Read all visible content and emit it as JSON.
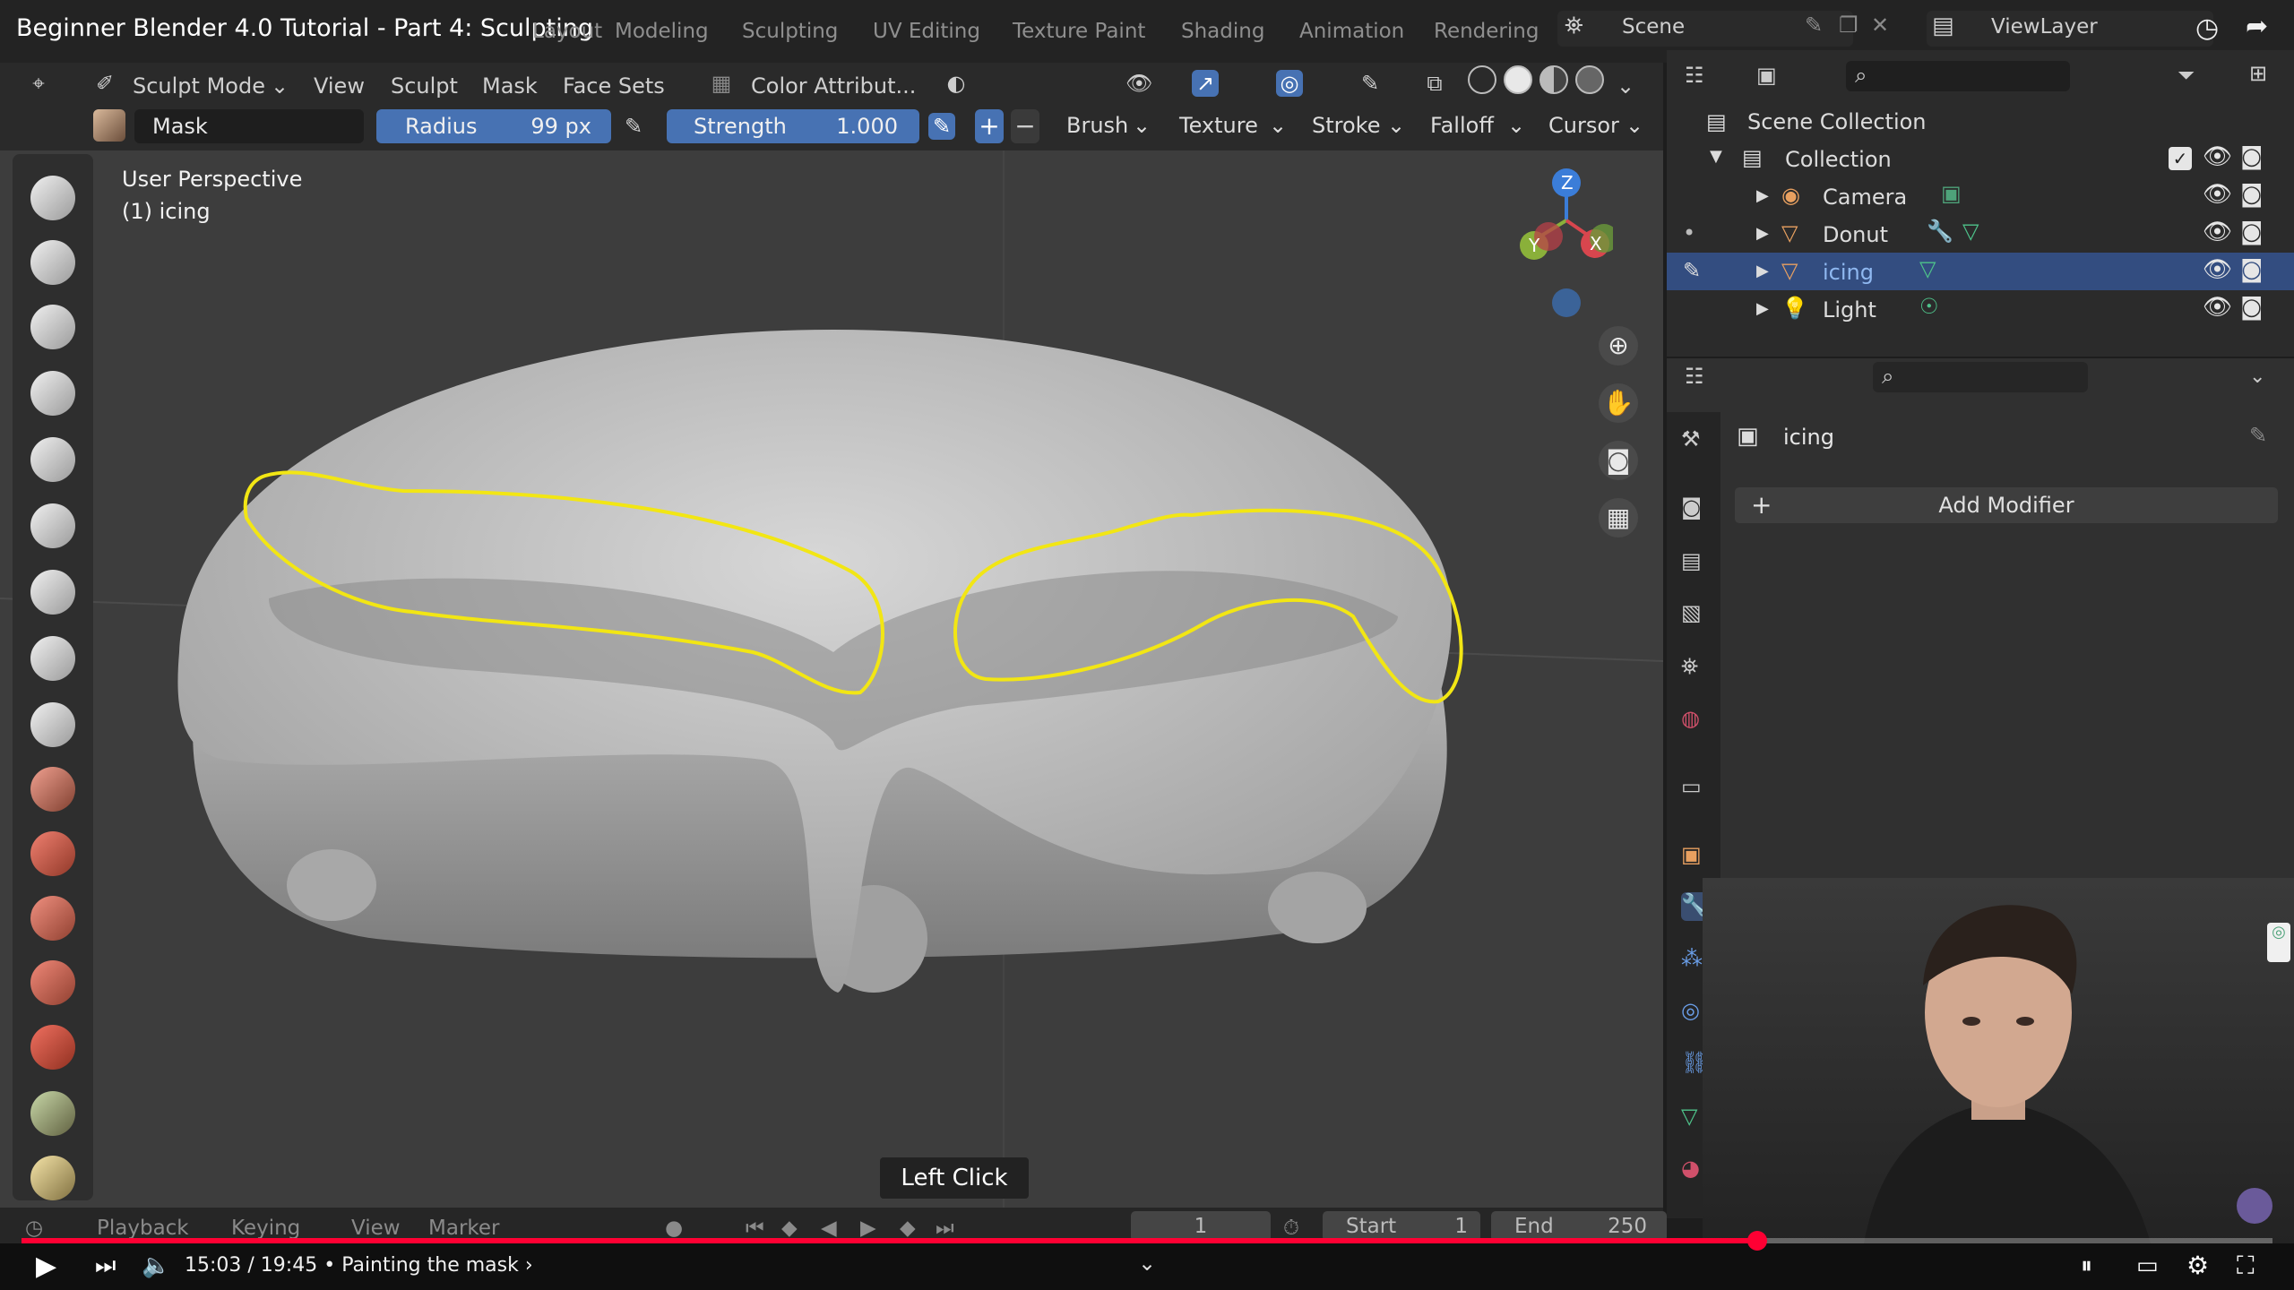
{
  "video": {
    "title": "Beginner Blender 4.0 Tutorial - Part 4: Sculpting",
    "time": "15:03 / 19:45",
    "chapter": "Painting the mask",
    "progress_fraction": 0.7711
  },
  "workspace_tabs": [
    "Layout",
    "Modeling",
    "Sculpting",
    "UV Editing",
    "Texture Paint",
    "Shading",
    "Animation",
    "Rendering"
  ],
  "scene": {
    "label": "Scene"
  },
  "view_layer": {
    "label": "ViewLayer"
  },
  "header": {
    "mode": "Sculpt Mode",
    "menus": [
      "View",
      "Sculpt",
      "Mask",
      "Face Sets"
    ],
    "color_attribute": "Color Attribut..."
  },
  "tool_settings": {
    "brush_name": "Mask",
    "radius_label": "Radius",
    "radius_value": "99 px",
    "strength_label": "Strength",
    "strength_value": "1.000",
    "plus": "+",
    "minus": "−",
    "dropdowns": [
      "Brush",
      "Texture",
      "Stroke",
      "Falloff",
      "Cursor"
    ]
  },
  "viewport": {
    "perspective": "User Perspective",
    "object": "(1) icing",
    "gizmo": {
      "z": "Z",
      "y": "Y",
      "x": "X"
    },
    "hint": "Left Click"
  },
  "outliner": {
    "scene_collection": "Scene Collection",
    "collection": "Collection",
    "items": [
      {
        "label": "Camera"
      },
      {
        "label": "Donut"
      },
      {
        "label": "icing",
        "selected": true
      },
      {
        "label": "Light"
      }
    ]
  },
  "properties": {
    "object_name": "icing",
    "add_modifier": "Add Modifier"
  },
  "timeline": {
    "menus": [
      "Playback",
      "Keying",
      "View",
      "Marker"
    ],
    "current_frame": "1",
    "start_label": "Start",
    "start_value": "1",
    "end_label": "End",
    "end_value": "250"
  },
  "colors": {
    "accent": "#4772b3",
    "mask_outline": "#f2e614",
    "progress": "#ff0033",
    "selected_row": "#334d80"
  }
}
